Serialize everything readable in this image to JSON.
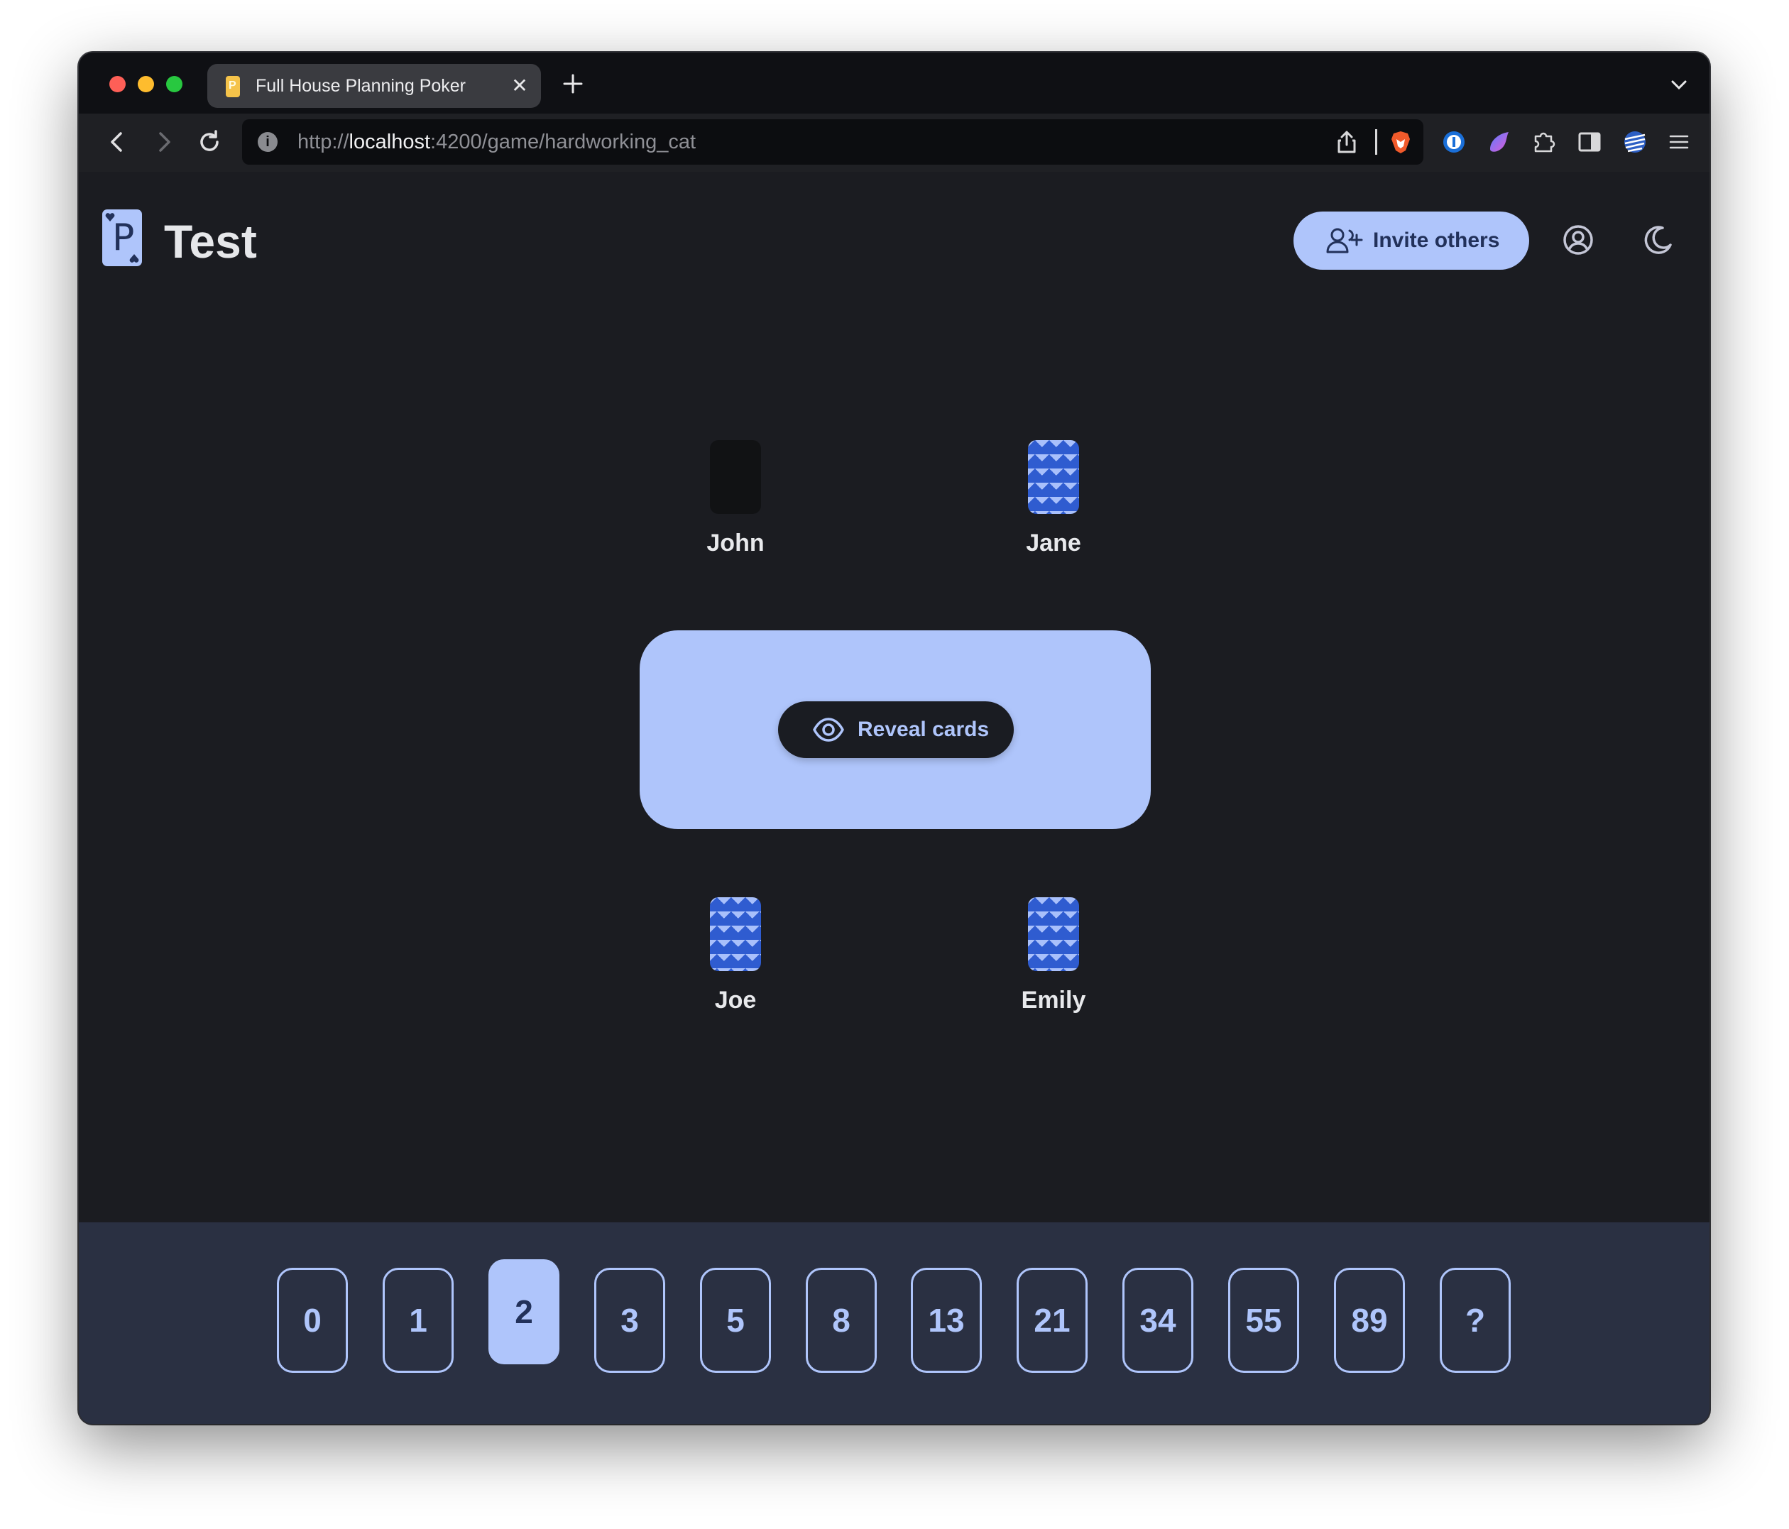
{
  "browser": {
    "tab_title": "Full House Planning Poker",
    "url_scheme": "http://",
    "url_host": "localhost",
    "url_rest": ":4200/game/hardworking_cat"
  },
  "header": {
    "title": "Test",
    "invite_label": "Invite others"
  },
  "players": [
    {
      "name": "John",
      "card": "empty"
    },
    {
      "name": "Jane",
      "card": "back"
    },
    {
      "name": "Joe",
      "card": "back"
    },
    {
      "name": "Emily",
      "card": "back"
    }
  ],
  "table": {
    "reveal_label": "Reveal cards"
  },
  "deck": {
    "cards": [
      "0",
      "1",
      "2",
      "3",
      "5",
      "8",
      "13",
      "21",
      "34",
      "55",
      "89",
      "?"
    ],
    "selected": "2"
  },
  "colors": {
    "accent": "#afc5fb",
    "background": "#1b1c21",
    "deck_background": "#2a3042",
    "card_pattern": "#2f5cd0"
  },
  "icons": {
    "logo": "poker-card-logo",
    "invite": "user-plus-icon",
    "account": "user-circle-icon",
    "theme": "moon-icon",
    "reveal": "eye-icon"
  }
}
